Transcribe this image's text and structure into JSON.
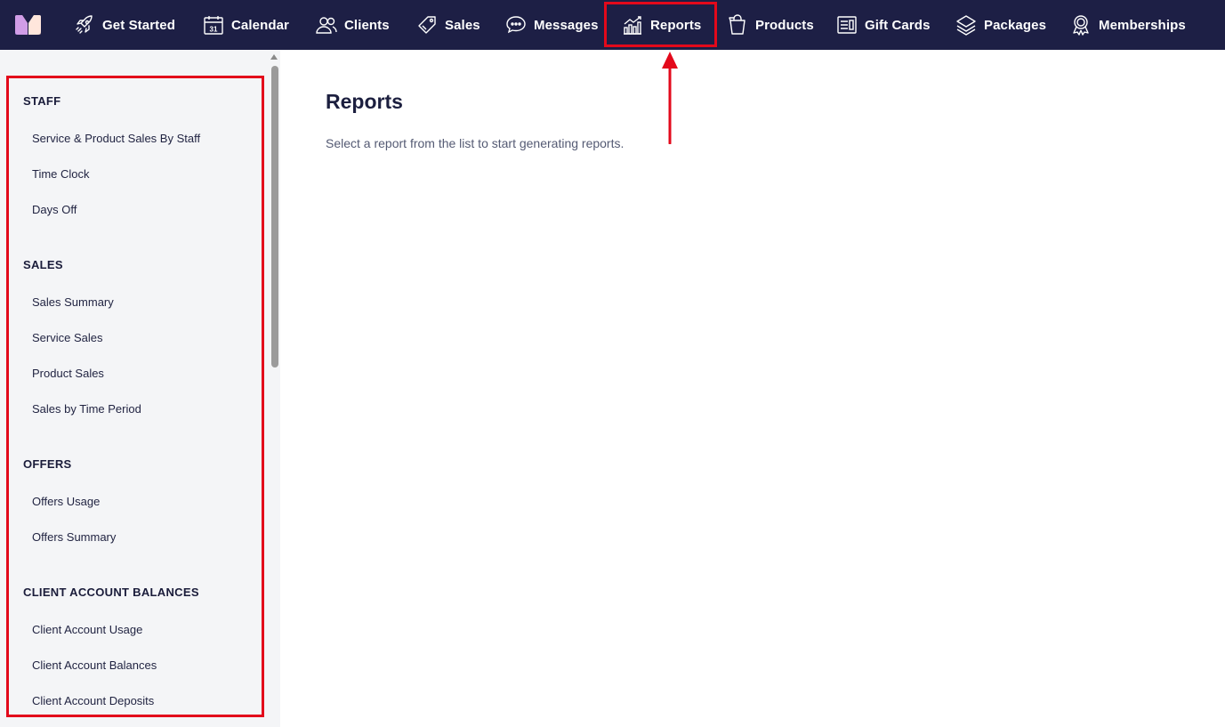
{
  "nav": {
    "items": [
      {
        "label": "Get Started",
        "icon": "rocket-icon"
      },
      {
        "label": "Calendar",
        "icon": "calendar-icon",
        "icon_text": "31"
      },
      {
        "label": "Clients",
        "icon": "users-icon"
      },
      {
        "label": "Sales",
        "icon": "tag-icon"
      },
      {
        "label": "Messages",
        "icon": "chat-icon"
      },
      {
        "label": "Reports",
        "icon": "bar-chart-icon",
        "active": true
      },
      {
        "label": "Products",
        "icon": "shopping-bag-icon"
      },
      {
        "label": "Gift Cards",
        "icon": "gift-card-icon"
      },
      {
        "label": "Packages",
        "icon": "layers-icon"
      },
      {
        "label": "Memberships",
        "icon": "badge-icon"
      }
    ]
  },
  "sidebar": {
    "sections": [
      {
        "title": "STAFF",
        "items": [
          "Service & Product Sales By Staff",
          "Time Clock",
          "Days Off"
        ]
      },
      {
        "title": "SALES",
        "items": [
          "Sales Summary",
          "Service Sales",
          "Product Sales",
          "Sales by Time Period"
        ]
      },
      {
        "title": "OFFERS",
        "items": [
          "Offers Usage",
          "Offers Summary"
        ]
      },
      {
        "title": "CLIENT ACCOUNT BALANCES",
        "items": [
          "Client Account Usage",
          "Client Account Balances",
          "Client Account Deposits"
        ]
      }
    ]
  },
  "main": {
    "title": "Reports",
    "subtitle": "Select a report from the list to start generating reports."
  },
  "colors": {
    "nav_bg": "#1d1f45",
    "sidebar_bg": "#f4f5f7",
    "annotation": "#e3091b",
    "logo_primary": "#b98cf0",
    "logo_secondary": "#ffb199"
  }
}
